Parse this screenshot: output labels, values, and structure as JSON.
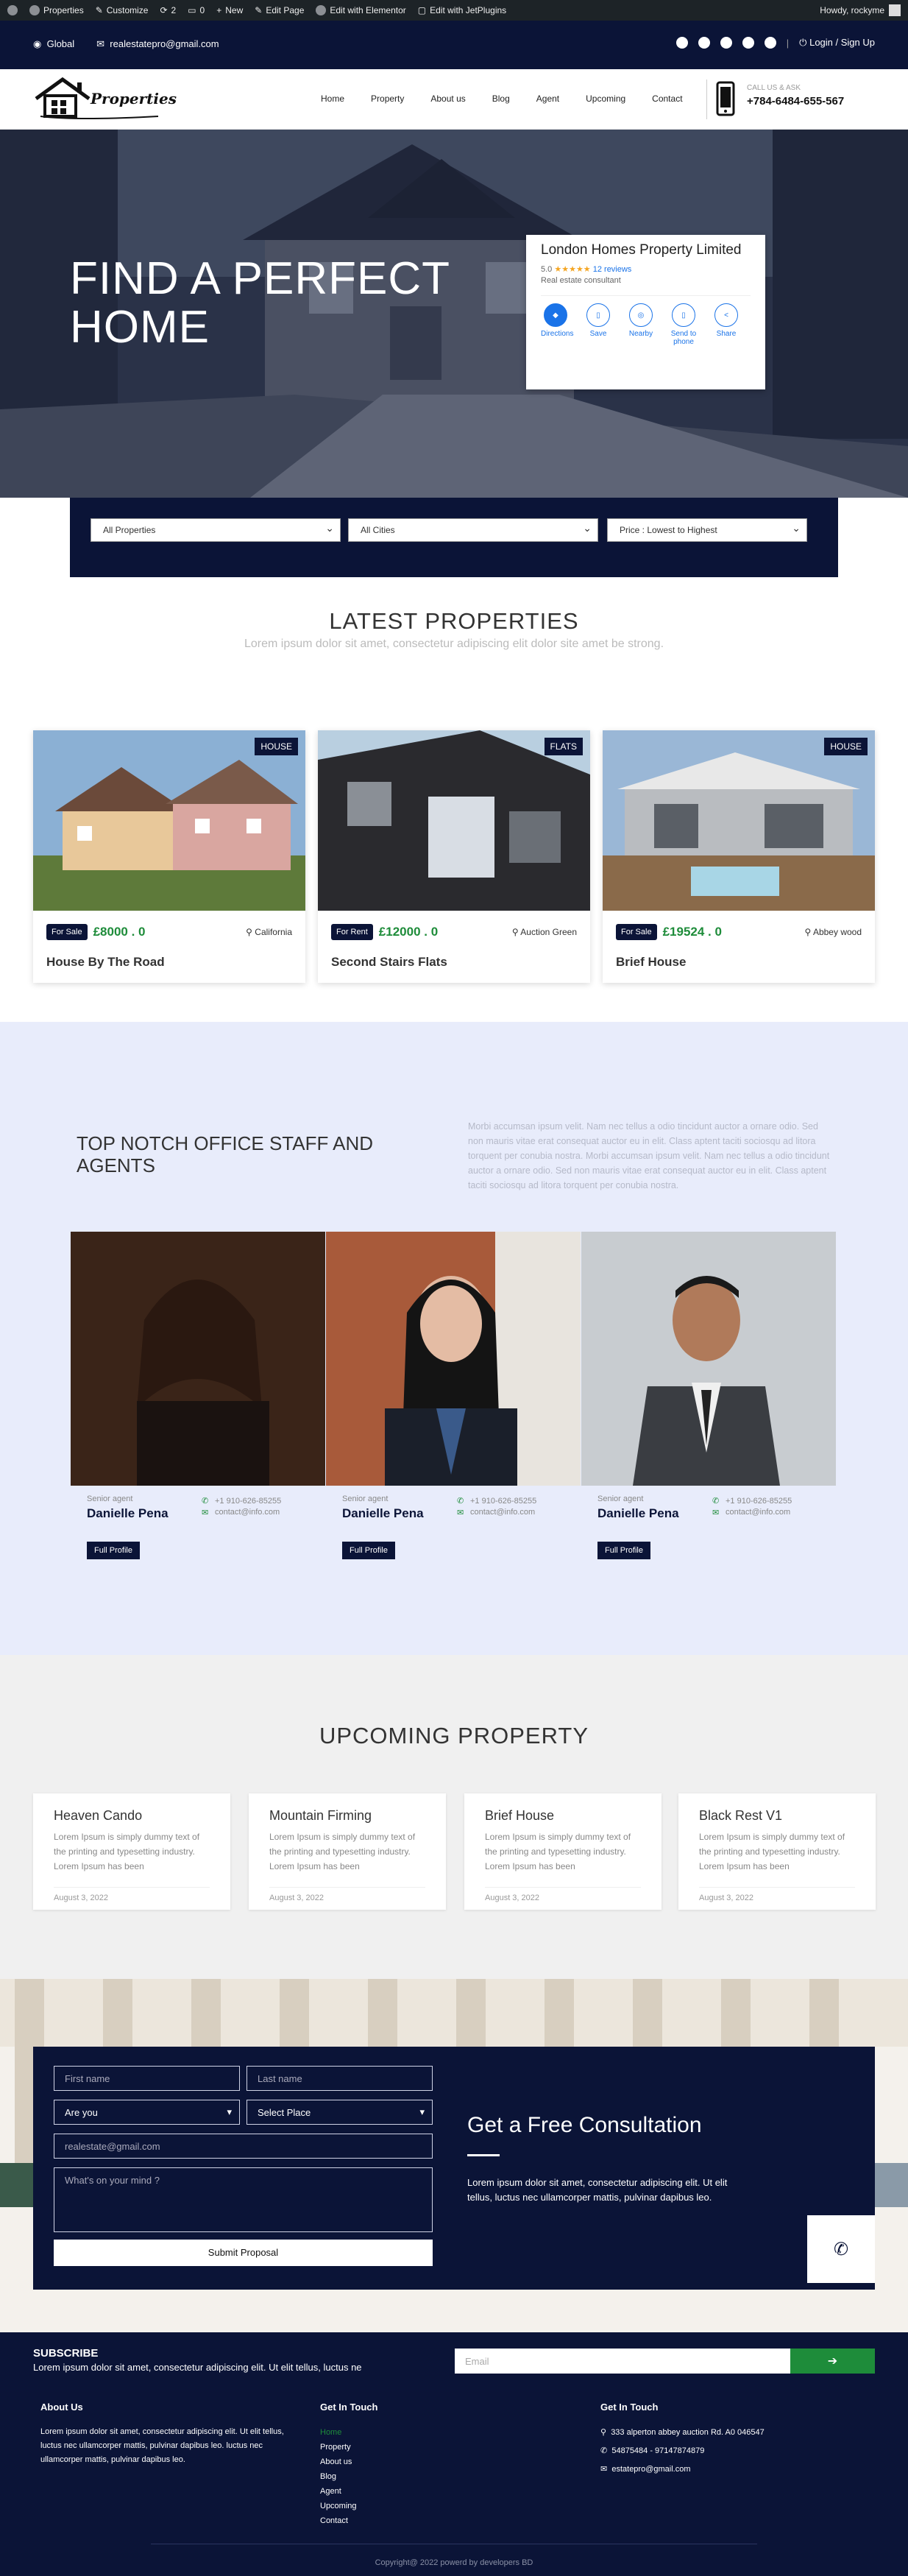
{
  "admin_bar": {
    "items": [
      "Properties",
      "Customize",
      "2",
      "0",
      "New",
      "Edit Page",
      "Edit with Elementor",
      "Edit with JetPlugins"
    ],
    "greeting": "Howdy, rockyme"
  },
  "topbar": {
    "global": "Global",
    "email": "realestatepro@gmail.com",
    "login": "Login / Sign Up"
  },
  "header": {
    "logo_text": "Properties",
    "nav": [
      "Home",
      "Property",
      "About us",
      "Blog",
      "Agent",
      "Upcoming",
      "Contact"
    ],
    "call_label": "CALL US & ASK",
    "phone": "+784-6484-655-567"
  },
  "hero": {
    "title_line1": "FIND A PERFECT",
    "title_line2": "HOME",
    "card": {
      "name": "London Homes Property Limited",
      "rating": "5.0",
      "stars": "★★★★★",
      "reviews": "12 reviews",
      "subtitle": "Real estate consultant",
      "actions": [
        "Directions",
        "Save",
        "Nearby",
        "Send to phone",
        "Share"
      ]
    }
  },
  "search": {
    "select1": "All Properties",
    "select2": "All Cities",
    "select3": "Price : Lowest to Highest"
  },
  "latest": {
    "title": "LATEST PROPERTIES",
    "subtitle": "Lorem ipsum dolor sit amet, consectetur adipiscing elit dolor site amet be strong.",
    "items": [
      {
        "tag": "HOUSE",
        "status": "For Sale",
        "price": "£8000 . 0",
        "location": "California",
        "name": "House By The Road"
      },
      {
        "tag": "FLATS",
        "status": "For Rent",
        "price": "£12000 . 0",
        "location": "Auction Green",
        "name": "Second Stairs Flats"
      },
      {
        "tag": "HOUSE",
        "status": "For Sale",
        "price": "£19524 . 0",
        "location": "Abbey wood",
        "name": "Brief House"
      }
    ]
  },
  "agents": {
    "title": "TOP NOTCH OFFICE STAFF AND AGENTS",
    "text": "Morbi accumsan ipsum velit. Nam nec tellus a odio tincidunt auctor a ornare odio. Sed non mauris vitae erat consequat auctor eu in elit. Class aptent taciti sociosqu ad litora torquent per conubia nostra. Morbi accumsan ipsum velit. Nam nec tellus a odio tincidunt auctor a ornare odio. Sed non mauris vitae erat consequat auctor eu in elit. Class aptent taciti sociosqu ad litora torquent per conubia nostra.",
    "items": [
      {
        "role": "Senior agent",
        "name": "Danielle Pena",
        "phone": "+1 910-626-85255",
        "email": "contact@info.com",
        "button": "Full Profile"
      },
      {
        "role": "Senior agent",
        "name": "Danielle Pena",
        "phone": "+1 910-626-85255",
        "email": "contact@info.com",
        "button": "Full Profile"
      },
      {
        "role": "Senior agent",
        "name": "Danielle Pena",
        "phone": "+1 910-626-85255",
        "email": "contact@info.com",
        "button": "Full Profile"
      }
    ]
  },
  "upcoming": {
    "title": "UPCOMING PROPERTY",
    "items": [
      {
        "name": "Heaven Cando",
        "text": "Lorem Ipsum is simply dummy text of the printing and typesetting industry. Lorem Ipsum has been",
        "date": "August 3, 2022"
      },
      {
        "name": "Mountain Firming",
        "text": "Lorem Ipsum is simply dummy text of the printing and typesetting industry. Lorem Ipsum has been",
        "date": "August 3, 2022"
      },
      {
        "name": "Brief House",
        "text": "Lorem Ipsum is simply dummy text of the printing and typesetting industry. Lorem Ipsum has been",
        "date": "August 3, 2022"
      },
      {
        "name": "Black Rest V1",
        "text": "Lorem Ipsum is simply dummy text of the printing and typesetting industry. Lorem Ipsum has been",
        "date": "August 3, 2022"
      }
    ]
  },
  "consult": {
    "first_name": "First name",
    "last_name": "Last name",
    "are_you": "Are you",
    "select_place": "Select Place",
    "email": "realestate@gmail.com",
    "message": "What's on your mind ?",
    "submit": "Submit Proposal",
    "title": "Get a Free Consultation",
    "text": "Lorem ipsum dolor sit amet, consectetur adipiscing elit. Ut elit tellus, luctus nec ullamcorper mattis, pulvinar dapibus leo."
  },
  "footer": {
    "subscribe_title": "SUBSCRIBE",
    "subscribe_text": "Lorem ipsum dolor sit amet, consectetur adipiscing elit. Ut elit tellus, luctus ne",
    "email_placeholder": "Email",
    "about_title": "About Us",
    "about_text": "Lorem ipsum dolor sit amet, consectetur adipiscing elit. Ut elit tellus, luctus nec ullamcorper mattis, pulvinar dapibus leo. luctus nec ullamcorper mattis, pulvinar dapibus leo.",
    "links_title": "Get In Touch",
    "links": [
      "Home",
      "Property",
      "About us",
      "Blog",
      "Agent",
      "Upcoming",
      "Contact"
    ],
    "contact_title": "Get In Touch",
    "address": "333 alperton abbey auction Rd. A0 046547",
    "phone": "54875484 - 97147874879",
    "email": "estatepro@gmail.com",
    "copyright": "Copyright@ 2022 powerd by developers BD"
  }
}
